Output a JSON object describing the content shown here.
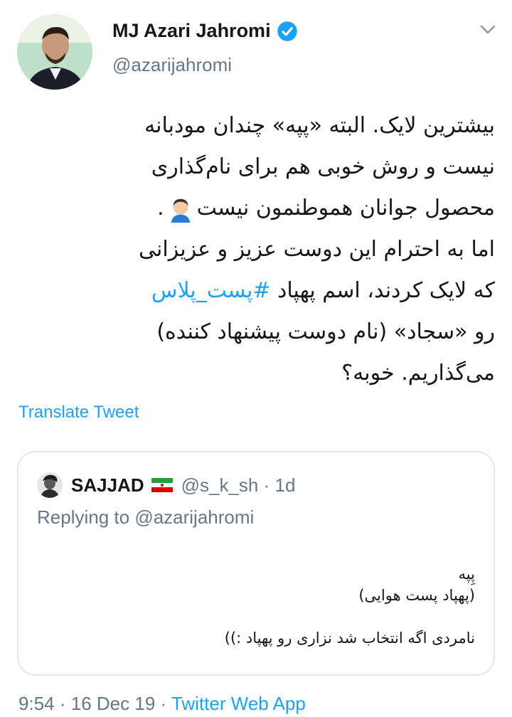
{
  "author": {
    "name": "MJ Azari Jahromi",
    "handle": "@azarijahromi",
    "avatar_icon": "profile-photo"
  },
  "tweet": {
    "lines": [
      "بیشترین لایک. البته «پپه» چندان مودبانه",
      "نیست و روش خوبی هم برای نام‌گذاری",
      "محصول جوانان هموطنمون نیست",
      ".",
      "اما به احترام این دوست عزیز و عزیزانی",
      "که لایک کردند، اسم پهپاد",
      "#پست_پلاس",
      "رو «سجاد» (نام دوست پیشنهاد کننده)",
      "می‌گذاریم. خوبه؟"
    ],
    "translate_label": "Translate Tweet"
  },
  "quoted": {
    "name": "SAJJAD",
    "handle": "@s_k_sh",
    "separator": "·",
    "time": "1d",
    "replying_prefix": "Replying to",
    "replying_to": "@azarijahromi",
    "lines": [
      "پِپه",
      "(پهپاد پست هوایی)",
      "",
      "نامردی اگه انتخاب شد نزاری رو پهپاد :))"
    ]
  },
  "footer": {
    "time": "9:54",
    "sep1": "·",
    "date": "16 Dec 19",
    "sep2": "·",
    "app": "Twitter Web App"
  },
  "colors": {
    "link": "#1da1f2",
    "secondary_text": "#657786",
    "border": "#e1e8ed"
  }
}
